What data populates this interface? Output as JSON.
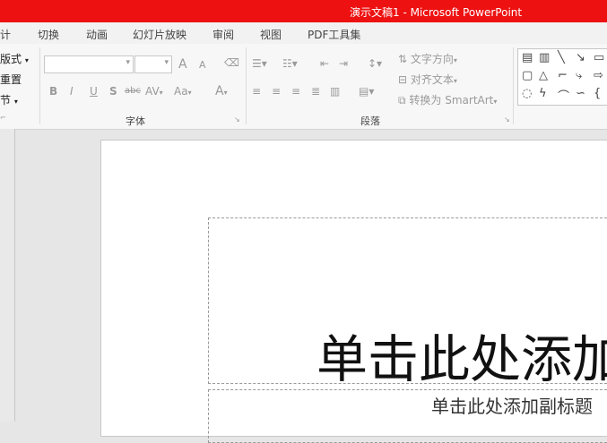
{
  "app": {
    "title": "演示文稿1 -  Microsoft PowerPoint"
  },
  "tabs": [
    {
      "label": "计"
    },
    {
      "label": "切换"
    },
    {
      "label": "动画"
    },
    {
      "label": "幻灯片放映"
    },
    {
      "label": "审阅"
    },
    {
      "label": "视图"
    },
    {
      "label": "PDF工具集"
    }
  ],
  "ribbon": {
    "slides_group": {
      "layout_label": "版式",
      "reset_label": "重置",
      "section_label": "节"
    },
    "font_group": {
      "label": "字体",
      "font_name": "",
      "font_size": "",
      "grow_font": "A",
      "shrink_font": "A",
      "bold": "B",
      "italic": "I",
      "underline": "U",
      "shadow": "S",
      "strike": "abc",
      "spacing": "AV",
      "change_case": "Aa",
      "font_color": "A"
    },
    "paragraph_group": {
      "label": "段落",
      "text_direction": "文字方向",
      "align_text": "对齐文本",
      "convert_smartart": "转换为 SmartArt"
    }
  },
  "slide": {
    "title_placeholder": "单击此处添加标题",
    "subtitle_placeholder": "单击此处添加副标题"
  },
  "colors": {
    "titlebar": "#ee1111",
    "ribbon": "#f7f7f7",
    "workspace": "#e6e6e6"
  }
}
